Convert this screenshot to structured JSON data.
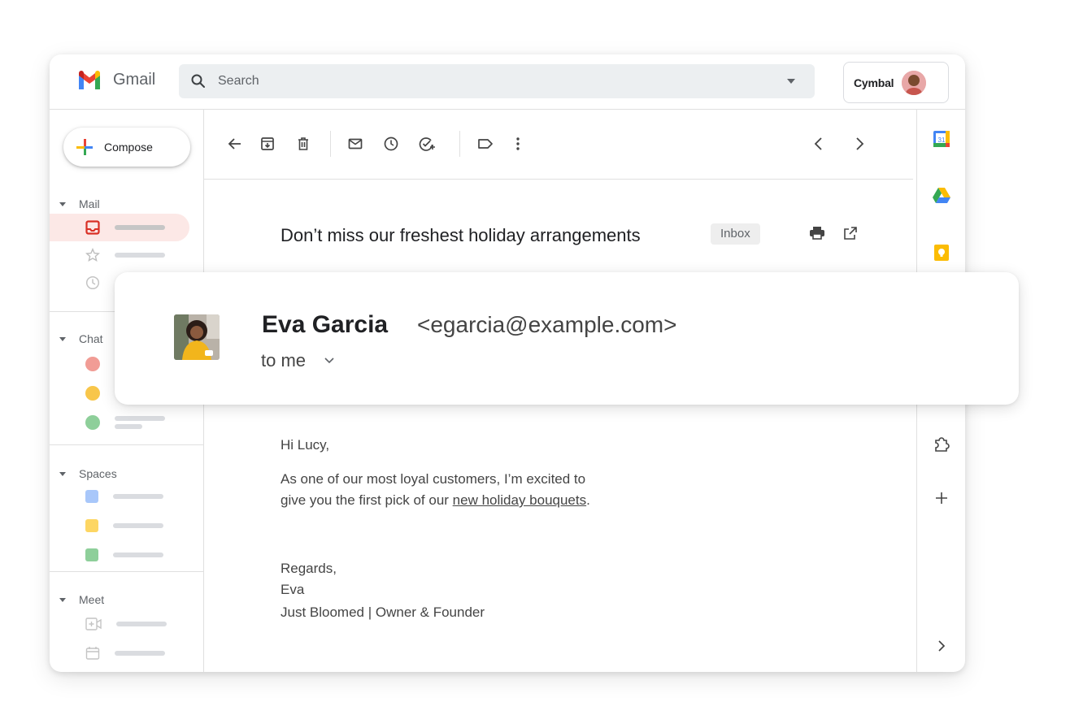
{
  "app": {
    "title": "Gmail",
    "brand": "Cymbal"
  },
  "search": {
    "placeholder": "Search"
  },
  "sidebar": {
    "compose_label": "Compose",
    "sections": {
      "mail": "Mail",
      "chat": "Chat",
      "spaces": "Spaces",
      "meet": "Meet"
    }
  },
  "email": {
    "subject": "Don’t miss our freshest holiday arrangements",
    "label": "Inbox",
    "sender_name": "Eva Garcia",
    "sender_email": "<egarcia@example.com>",
    "recipient": "to me",
    "greeting": "Hi Lucy,",
    "body_line1": "As one of our most loyal customers, I’m excited to",
    "body_line2_prefix": "give you the first pick of our ",
    "body_link": "new holiday bouquets",
    "body_line2_suffix": ".",
    "signoff": "Regards,",
    "signature_name": "Eva",
    "signature_title": "Just Bloomed | Owner & Founder"
  },
  "colors": {
    "gmail_red": "#ea4335",
    "gmail_blue": "#4285f4",
    "gmail_green": "#34a853",
    "gmail_yellow": "#fbbc04",
    "active_bg": "#fce8e6"
  }
}
